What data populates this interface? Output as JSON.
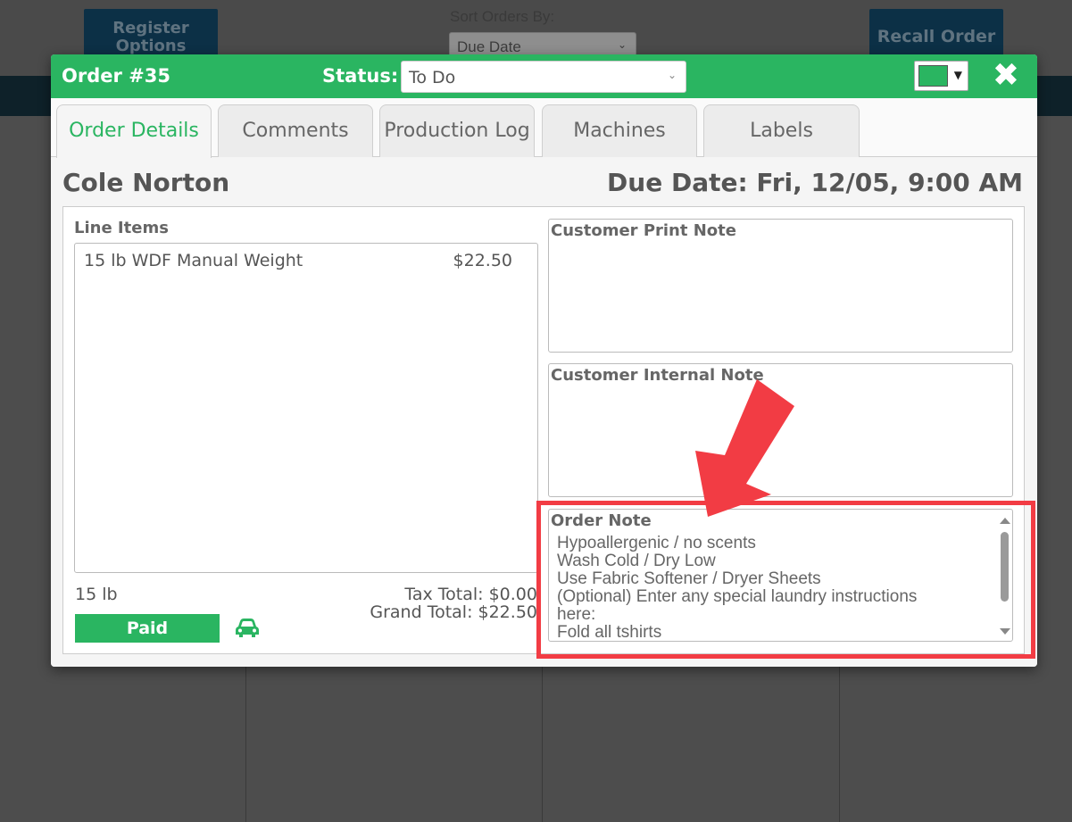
{
  "background": {
    "register_options_label": "Register Options",
    "sort_label": "Sort Orders By:",
    "sort_value": "Due Date",
    "recall_order_label": "Recall Order"
  },
  "modal": {
    "order_title": "Order #35",
    "status_label": "Status:",
    "status_value": "To Do",
    "color_value": "#2ab561",
    "tabs": [
      {
        "label": "Order Details",
        "active": true
      },
      {
        "label": "Comments",
        "active": false
      },
      {
        "label": "Production Log",
        "active": false
      },
      {
        "label": "Machines",
        "active": false
      },
      {
        "label": "Labels",
        "active": false
      }
    ],
    "customer_name": "Cole Norton",
    "due_date": "Due Date: Fri, 12/05, 9:00 AM",
    "line_items_label": "Line Items",
    "line_items": [
      {
        "name": "15 lb WDF Manual Weight",
        "price": "$22.50"
      }
    ],
    "weight_total": "15 lb",
    "tax_total": "Tax Total: $0.00",
    "grand_total": "Grand Total: $22.50",
    "paid_label": "Paid",
    "customer_print_note_label": "Customer Print Note",
    "customer_internal_note_label": "Customer Internal Note",
    "order_note_label": "Order Note",
    "order_note_lines": [
      "Hypoallergenic / no scents",
      "Wash Cold / Dry Low",
      "Use Fabric Softener / Dryer Sheets",
      "(Optional) Enter any special laundry instructions",
      "here:",
      "Fold all tshirts"
    ]
  },
  "colors": {
    "brand_green": "#2ab561",
    "annotation_red": "#f23c44"
  },
  "icons": {
    "close": "close-icon",
    "car": "car-icon"
  }
}
